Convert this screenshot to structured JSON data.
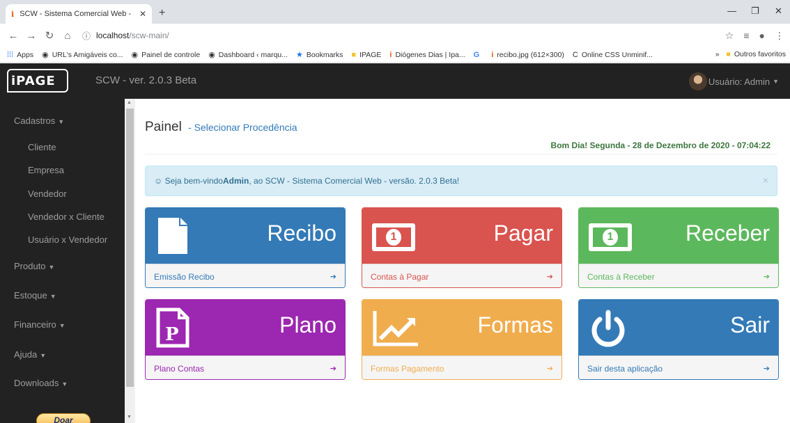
{
  "browser": {
    "tab_title": "SCW - Sistema Comercial Web -",
    "url_host": "localhost",
    "url_path": "/scw-main/",
    "bookmarks": [
      {
        "icon": "apps-grid-icon",
        "label": "Apps"
      },
      {
        "icon": "globe-icon",
        "label": "URL's Amigáveis co..."
      },
      {
        "icon": "globe-icon",
        "label": "Painel de controle"
      },
      {
        "icon": "globe-icon",
        "label": "Dashboard ‹ marqu..."
      },
      {
        "icon": "star-icon",
        "label": "Bookmarks"
      },
      {
        "icon": "folder-icon",
        "label": "IPAGE"
      },
      {
        "icon": "ipage-icon",
        "label": "Diógenes Dias | Ipa..."
      },
      {
        "icon": "google-icon",
        "label": ""
      },
      {
        "icon": "ipage-icon",
        "label": "recibo.jpg (612×300)"
      },
      {
        "icon": "c-icon",
        "label": "Online CSS Unminif..."
      }
    ],
    "other_bookmarks": "Outros favoritos"
  },
  "app": {
    "brand": "iPAGE",
    "version": "SCW - ver. 2.0.3 Beta",
    "user_label": "Usuário: Admin"
  },
  "sidebar": {
    "cadastros": "Cadastros",
    "cadastros_items": [
      "Cliente",
      "Empresa",
      "Vendedor",
      "Vendedor x Cliente",
      "Usuário x Vendedor"
    ],
    "produto": "Produto",
    "estoque": "Estoque",
    "financeiro": "Financeiro",
    "ajuda": "Ajuda",
    "downloads": "Downloads",
    "donate": "Doar"
  },
  "main": {
    "title": "Painel",
    "subtitle": "- Selecionar Procedência",
    "greeting": "Bom Dia! Segunda - 28 de Dezembro de 2020 - 07:04:22",
    "alert_prefix": "☺ Seja bem-vindo ",
    "alert_user": "Admin",
    "alert_suffix": ", ao SCW - Sistema Comercial Web - versão. 2.0.3 Beta!",
    "panels": [
      {
        "title": "Recibo",
        "footer": "Emissão Recibo",
        "color": "#337ab7"
      },
      {
        "title": "Pagar",
        "footer": "Contas à Pagar",
        "color": "#d9534f"
      },
      {
        "title": "Receber",
        "footer": "Contas à Receber",
        "color": "#5cb85c"
      },
      {
        "title": "Plano",
        "footer": "Plano Contas",
        "color": "#9c27b0"
      },
      {
        "title": "Formas",
        "footer": "Formas Pagamento",
        "color": "#f0ad4e"
      },
      {
        "title": "Sair",
        "footer": "Sair desta aplicação",
        "color": "#337ab7"
      }
    ]
  }
}
